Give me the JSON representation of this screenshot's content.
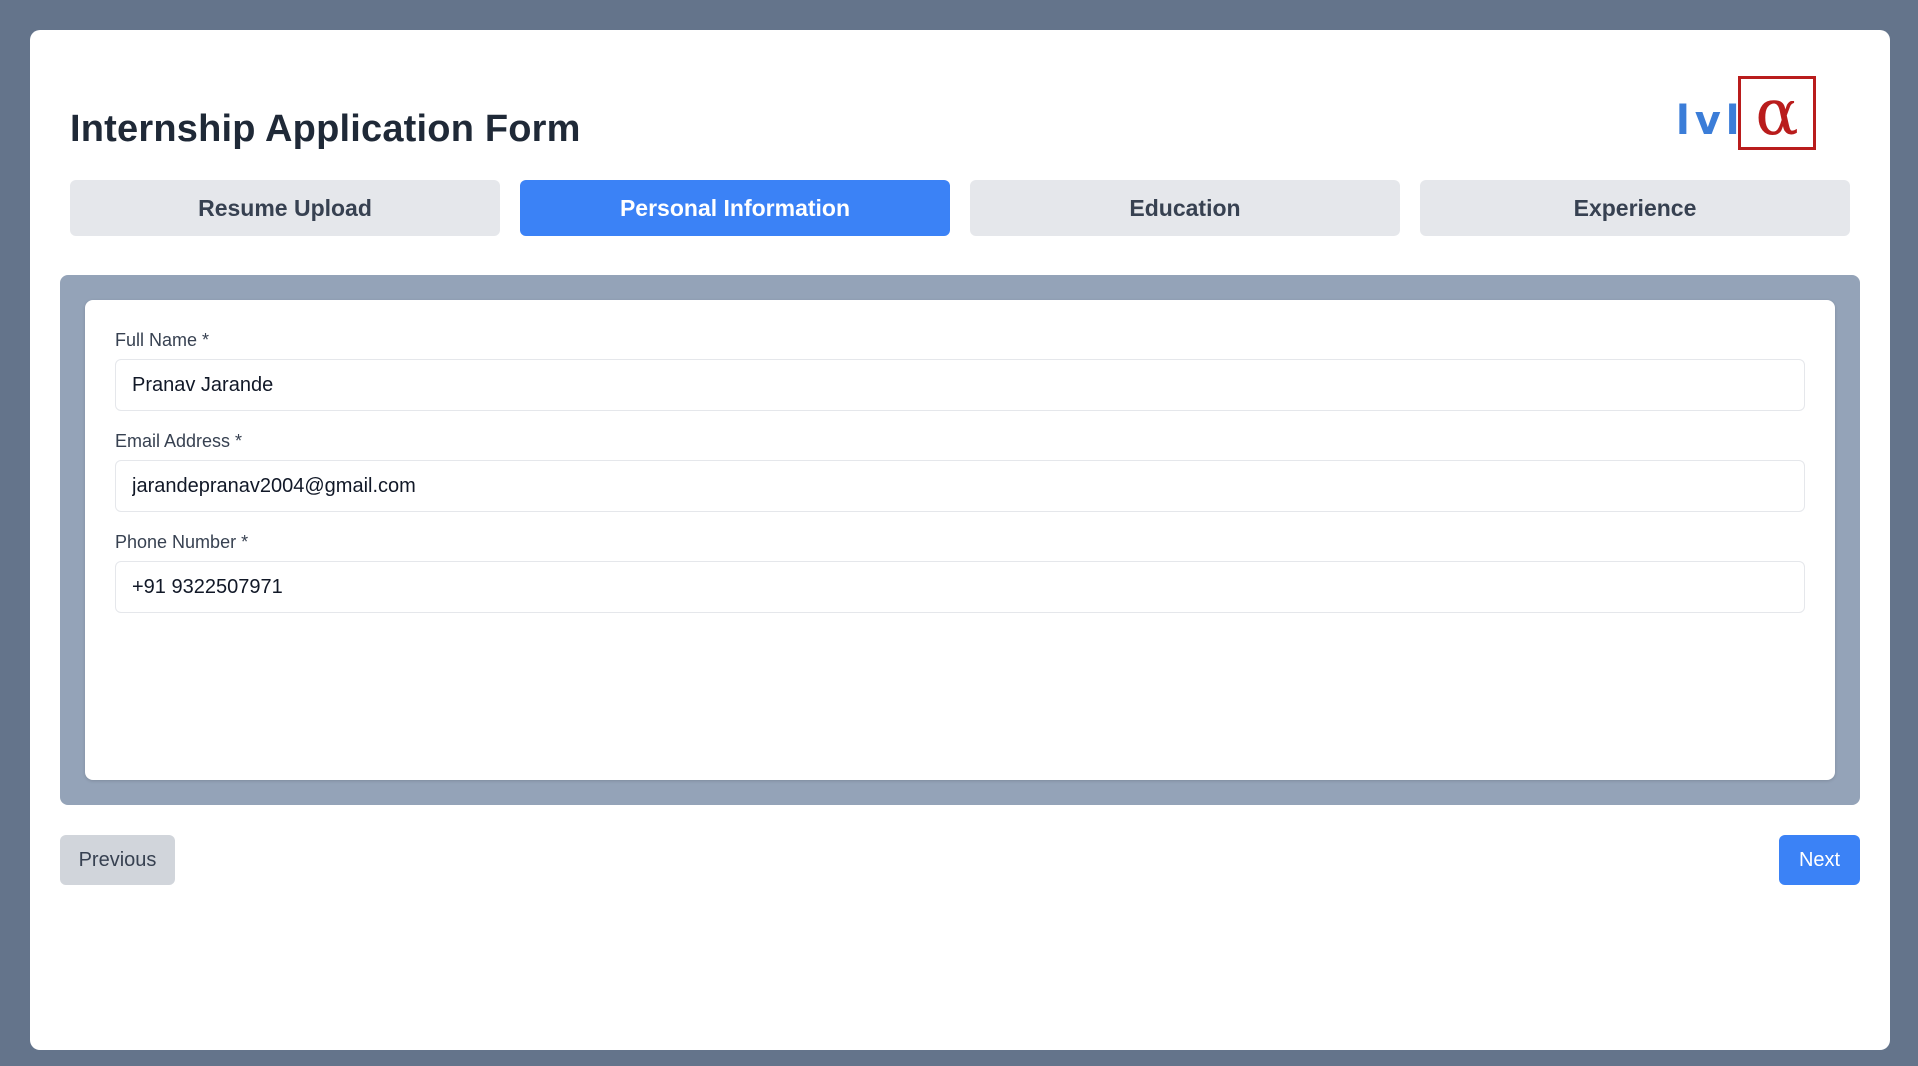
{
  "header": {
    "title": "Internship Application Form",
    "logo": {
      "text": "lvl",
      "symbol": "α",
      "text_color": "#3b7dd8",
      "box_color": "#b91c1c"
    }
  },
  "tabs": [
    {
      "label": "Resume Upload",
      "active": false
    },
    {
      "label": "Personal Information",
      "active": true
    },
    {
      "label": "Education",
      "active": false
    },
    {
      "label": "Experience",
      "active": false
    }
  ],
  "form": {
    "full_name": {
      "label": "Full Name *",
      "value": "Pranav Jarande"
    },
    "email": {
      "label": "Email Address *",
      "value": "jarandepranav2004@gmail.com"
    },
    "phone": {
      "label": "Phone Number *",
      "value": "+91 9322507971"
    }
  },
  "nav": {
    "previous_label": "Previous",
    "next_label": "Next"
  },
  "colors": {
    "background": "#64748b",
    "accent": "#3b82f6",
    "panel": "#94a3b8",
    "tab_inactive": "#e5e7eb"
  }
}
